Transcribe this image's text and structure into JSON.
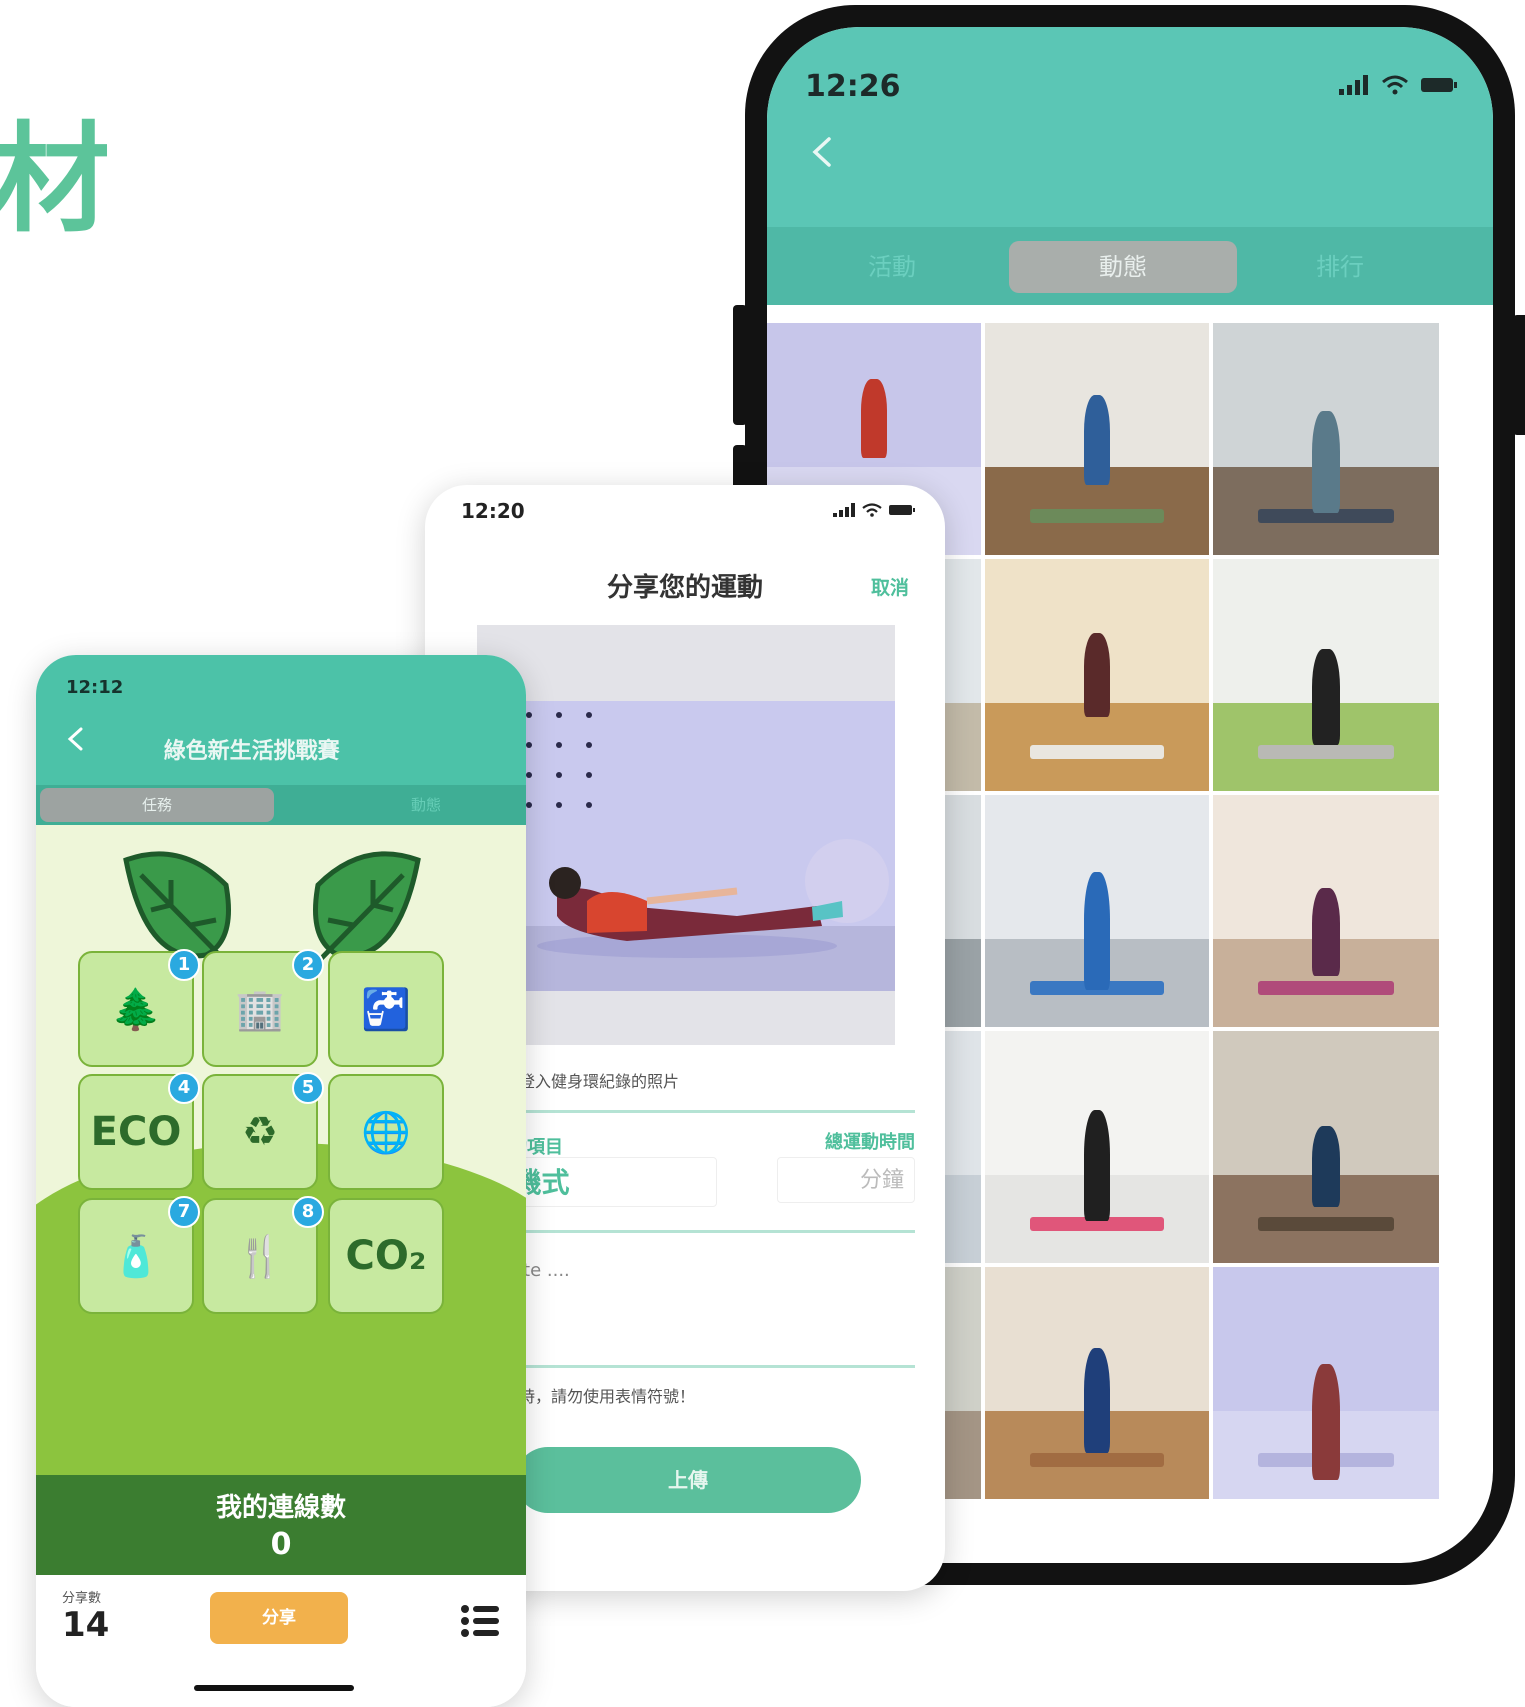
{
  "headline": "材",
  "feed_phone": {
    "time": "12:26",
    "tabs": [
      {
        "label": "活動",
        "active": false
      },
      {
        "label": "動態",
        "active": true
      },
      {
        "label": "排行",
        "active": false
      }
    ],
    "photo_count": 15
  },
  "share_phone": {
    "time": "12:20",
    "title": "分享您的運動",
    "cancel_label": "取消",
    "photo_caption": "選擇您要登入健身環紀錄的照片",
    "exercise_label": "選擇運動項目",
    "duration_label": "總運動時間",
    "exercise_value": "#飛機式",
    "duration_placeholder": "分鐘",
    "note_placeholder": "add note ....",
    "warning": "編輯文字時，請勿使用表情符號！",
    "upload_label": "上傳"
  },
  "challenge_phone": {
    "time": "12:12",
    "title": "綠色新生活挑戰賽",
    "tabs": [
      {
        "label": "任務",
        "active": true
      },
      {
        "label": "動態",
        "active": false
      }
    ],
    "tiles": [
      {
        "badge": "1",
        "icon": "trees-globe-icon"
      },
      {
        "badge": "2",
        "icon": "green-building-icon"
      },
      {
        "badge": "",
        "icon": "water-tap-icon"
      },
      {
        "badge": "4",
        "icon": "eco-globe-icon"
      },
      {
        "badge": "5",
        "icon": "recycle-leaves-icon"
      },
      {
        "badge": "",
        "icon": "hand-globe-icon"
      },
      {
        "badge": "7",
        "icon": "reusable-bottle-icon"
      },
      {
        "badge": "8",
        "icon": "leaf-fork-icon"
      },
      {
        "badge": "",
        "icon": "co2-icon"
      }
    ],
    "streak_label": "我的連線數",
    "streak_value": "0",
    "share_count_label": "分享數",
    "share_count": "14",
    "share_button_label": "分享"
  },
  "colors": {
    "teal": "#5bc6b5",
    "green_accent": "#4fbf9c",
    "hill_green": "#8cc43e",
    "dark_green": "#3b7d30",
    "share_orange": "#f2b14c"
  }
}
